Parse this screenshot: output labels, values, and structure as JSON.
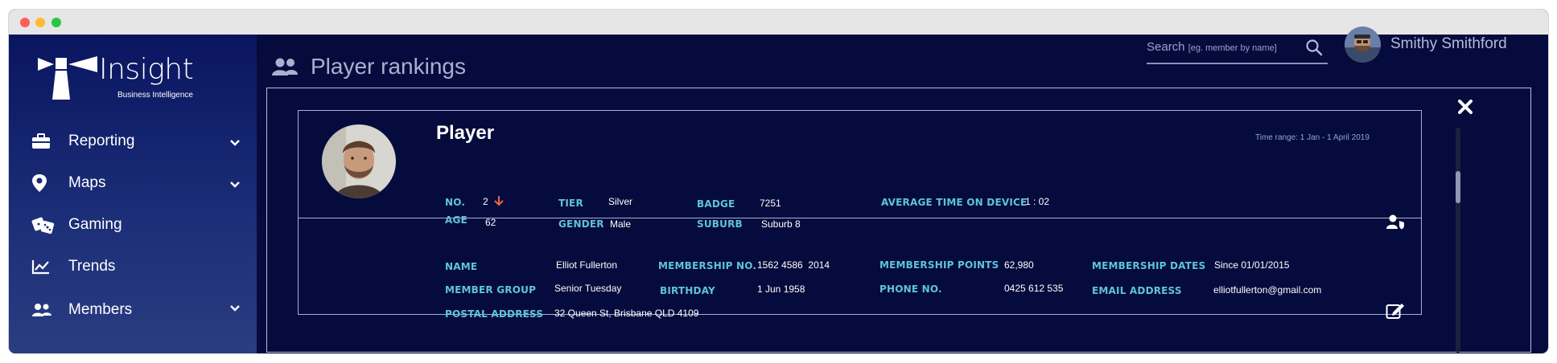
{
  "sidebar": {
    "logo_text": "Insight",
    "logo_sub": "Business Intelligence",
    "items": [
      {
        "label": "Reporting",
        "icon": "briefcase-icon",
        "has_chevron": true
      },
      {
        "label": "Maps",
        "icon": "map-pin-icon",
        "has_chevron": true
      },
      {
        "label": "Gaming",
        "icon": "dice-icon",
        "has_chevron": false
      },
      {
        "label": "Trends",
        "icon": "line-chart-icon",
        "has_chevron": false
      },
      {
        "label": "Members",
        "icon": "users-icon",
        "has_chevron": true
      }
    ]
  },
  "header": {
    "search_label": "Search",
    "search_hint": "[eg. member by name]",
    "user_name": "Smithy Smithford"
  },
  "page": {
    "title": "Player rankings"
  },
  "player": {
    "title": "Player",
    "time_range": "Time range: 1 Jan - 1 April 2019",
    "summary": {
      "no_label": "NO.",
      "no_value": "2",
      "age_label": "AGE",
      "age_value": "62",
      "tier_label": "TIER",
      "tier_value": "Silver",
      "gender_label": "GENDER",
      "gender_value": "Male",
      "badge_label": "BADGE",
      "badge_value": "7251",
      "suburb_label": "SUBURB",
      "suburb_value": "Suburb 8",
      "avg_time_label": "AVERAGE TIME ON DEVICE",
      "avg_time_value": "1 : 02"
    },
    "details": {
      "name_label": "NAME",
      "name_value": "Elliot Fullerton",
      "membership_no_label": "MEMBERSHIP NO.",
      "membership_no_value": "1562 4586  2014",
      "membership_points_label": "MEMBERSHIP POINTS",
      "membership_points_value": "62,980",
      "membership_dates_label": "MEMBERSHIP DATES",
      "membership_dates_value": "Since 01/01/2015",
      "member_group_label": "MEMBER GROUP",
      "member_group_value": "Senior Tuesday",
      "birthday_label": "BIRTHDAY",
      "birthday_value": "1 Jun 1958",
      "phone_label": "PHONE NO.",
      "phone_value": "0425 612 535",
      "email_label": "EMAIL ADDRESS",
      "email_value": "elliotfullerton@gmail.com",
      "postal_label": "POSTAL ADDRESS",
      "postal_value": "32 Queen St, Brisbane QLD 4109"
    }
  },
  "colors": {
    "background": "#060b3d",
    "label": "#5ec4d8",
    "rank_down": "#f0623f"
  }
}
